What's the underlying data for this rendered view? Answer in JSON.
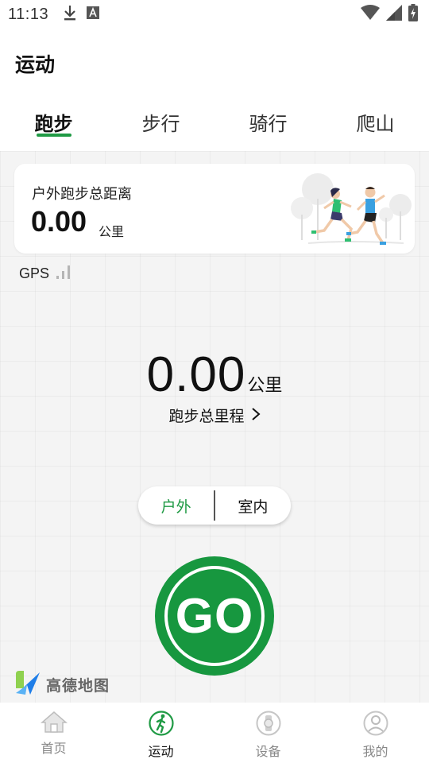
{
  "status_bar": {
    "time": "11:13"
  },
  "header": {
    "title": "运动"
  },
  "tabs": [
    {
      "label": "跑步",
      "active": true
    },
    {
      "label": "步行",
      "active": false
    },
    {
      "label": "骑行",
      "active": false
    },
    {
      "label": "爬山",
      "active": false
    }
  ],
  "summary_card": {
    "label": "户外跑步总距离",
    "value": "0.00",
    "unit": "公里"
  },
  "gps": {
    "label": "GPS"
  },
  "total": {
    "value": "0.00",
    "unit": "公里",
    "link_label": "跑步总里程"
  },
  "mode_toggle": {
    "options": [
      {
        "label": "户外",
        "active": true
      },
      {
        "label": "室内",
        "active": false
      }
    ]
  },
  "go_button": {
    "label": "GO"
  },
  "map_logo": {
    "text": "高德地图"
  },
  "bottom_nav": [
    {
      "label": "首页",
      "icon": "home-icon",
      "active": false
    },
    {
      "label": "运动",
      "icon": "run-icon",
      "active": true
    },
    {
      "label": "设备",
      "icon": "watch-icon",
      "active": false
    },
    {
      "label": "我的",
      "icon": "profile-icon",
      "active": false
    }
  ],
  "colors": {
    "accent": "#1f9a44",
    "go_button": "#17973f",
    "map_background": "#f4f4f4"
  }
}
